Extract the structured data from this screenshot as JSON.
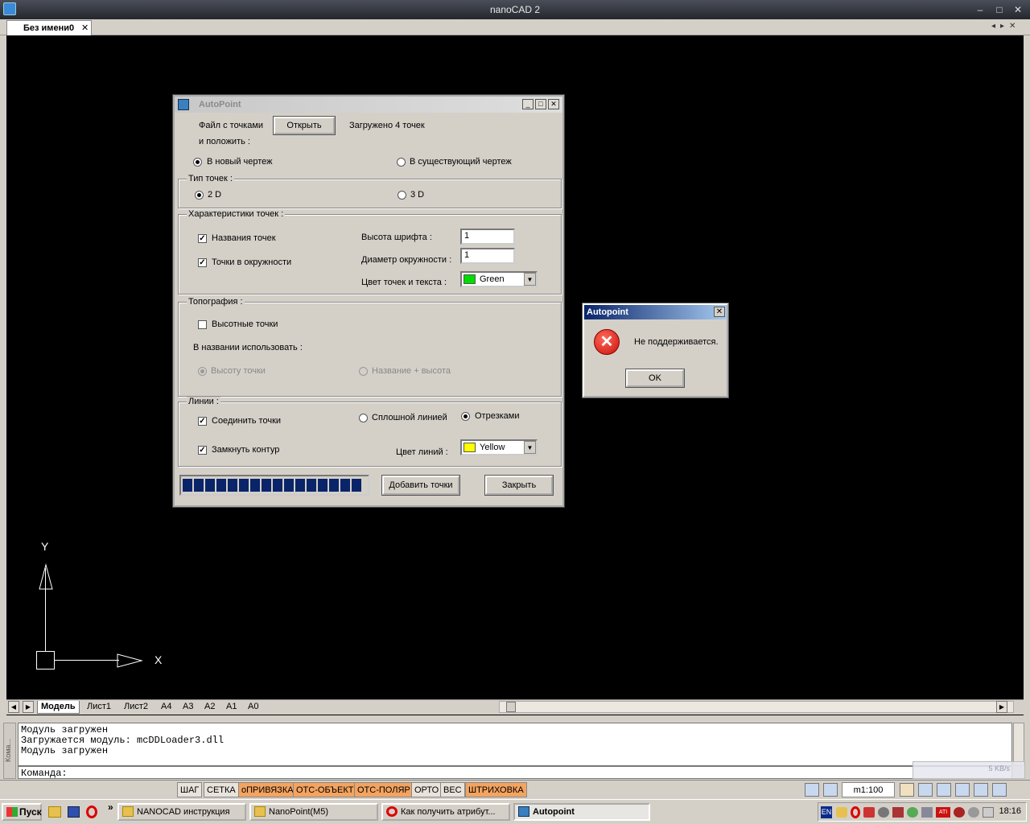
{
  "window": {
    "title": "nanoCAD 2",
    "min": "–",
    "max": "□",
    "close": "✕"
  },
  "doc_tab": {
    "label": "Без имени0",
    "close": "✕"
  },
  "ucs": {
    "x_label": "X",
    "y_label": "Y"
  },
  "layout_tabs": [
    "Модель",
    "Лист1",
    "Лист2",
    "A4",
    "A3",
    "A2",
    "A1",
    "A0"
  ],
  "command": {
    "log": [
      "Модуль загружен",
      "Загружается модуль: mcDDLoader3.dll",
      "Модуль загружен"
    ],
    "prompt": "Команда:",
    "side_label": "Кома..."
  },
  "net_speed": "5 KB/s",
  "status_buttons": [
    {
      "label": "ШАГ",
      "on": false
    },
    {
      "label": "СЕТКА",
      "on": false
    },
    {
      "label": "оПРИВЯЗКА",
      "on": true
    },
    {
      "label": "ОТС-ОБЪЕКТ",
      "on": true
    },
    {
      "label": "ОТС-ПОЛЯР",
      "on": true
    },
    {
      "label": "ОРТО",
      "on": false
    },
    {
      "label": "ВЕС",
      "on": false
    },
    {
      "label": "ШТРИХОВКА",
      "on": true
    }
  ],
  "scale": "m1:100",
  "taskbar": {
    "start": "Пуск",
    "items": [
      {
        "label": "NANOCAD инструкция",
        "active": false
      },
      {
        "label": "NanoPoint(M5)",
        "active": false
      },
      {
        "label": "Как получить атрибут...",
        "active": false
      },
      {
        "label": "Autopoint",
        "active": true
      }
    ],
    "lang": "EN",
    "clock": "18:16"
  },
  "dialog": {
    "title": "AutoPoint",
    "file_label": "Файл с точками",
    "open_button": "Открыть",
    "loaded_status": "Загружено 4 точек",
    "place_label": "и положить :",
    "new_drawing": "В новый чертеж",
    "existing_drawing": "В существующий чертеж",
    "point_type_group": "Тип точек :",
    "type_2d": "2 D",
    "type_3d": "3 D",
    "props_group": "Характеристики точек :",
    "point_names": "Названия точек",
    "points_in_circle": "Точки в окружности",
    "font_height_label": "Высота шрифта :",
    "font_height_value": "1",
    "circle_diameter_label": "Диаметр окружности :",
    "circle_diameter_value": "1",
    "point_color_label": "Цвет точек и текста :",
    "point_color_value": "Green",
    "point_color_hex": "#00dd00",
    "topo_group": "Топография :",
    "elevation_points": "Высотные точки",
    "name_use_label": "В названии использовать :",
    "use_height": "Высоту точки",
    "use_name_height": "Название + высота",
    "lines_group": "Линии :",
    "connect_points": "Соединить точки",
    "solid_line": "Сплошной линией",
    "segments": "Отрезками",
    "close_contour": "Замкнуть контур",
    "line_color_label": "Цвет линий :",
    "line_color_value": "Yellow",
    "line_color_hex": "#ffff00",
    "progress_fraction": 1.0,
    "add_button": "Добавить точки",
    "close_button": "Закрыть"
  },
  "error_dialog": {
    "title": "Autopoint",
    "message": "Не поддерживается.",
    "ok": "OK"
  }
}
